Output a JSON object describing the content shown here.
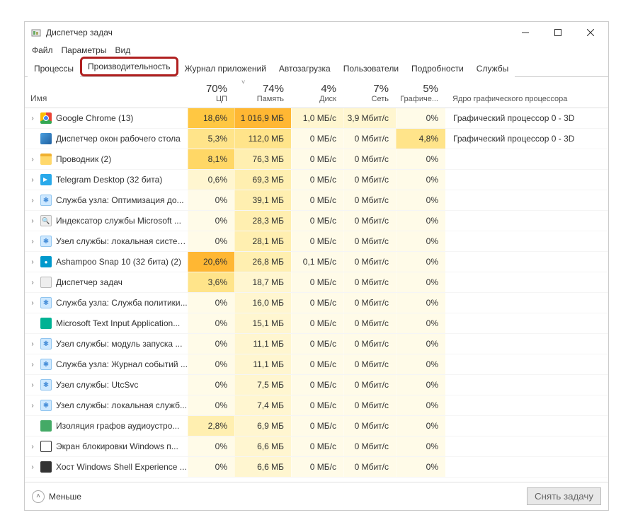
{
  "window": {
    "title": "Диспетчер задач"
  },
  "menu": {
    "file": "Файл",
    "options": "Параметры",
    "view": "Вид"
  },
  "tabs": {
    "processes": "Процессы",
    "performance": "Производительность",
    "app_history": "Журнал приложений",
    "startup": "Автозагрузка",
    "users": "Пользователи",
    "details": "Подробности",
    "services": "Службы"
  },
  "columns": {
    "name": "Имя",
    "cpu_pct": "70%",
    "cpu_label": "ЦП",
    "mem_pct": "74%",
    "mem_label": "Память",
    "disk_pct": "4%",
    "disk_label": "Диск",
    "net_pct": "7%",
    "net_label": "Сеть",
    "gpu_pct": "5%",
    "gpu_label": "Графиче...",
    "gpu_engine": "Ядро графического процессора"
  },
  "processes": [
    {
      "expand": true,
      "icon": "ic-chrome",
      "name": "Google Chrome (13)",
      "cpu": "18,6%",
      "cpu_h": 5,
      "mem": "1 016,9 МБ",
      "mem_h": 6,
      "disk": "1,0 МБ/с",
      "disk_h": 1,
      "net": "3,9 Мбит/с",
      "net_h": 1,
      "gpu": "0%",
      "gpu_h": 0,
      "engine": "Графический процессор 0 - 3D"
    },
    {
      "expand": false,
      "icon": "ic-dwm",
      "name": "Диспетчер окон рабочего стола",
      "cpu": "5,3%",
      "cpu_h": 3,
      "mem": "112,0 МБ",
      "mem_h": 3,
      "disk": "0 МБ/с",
      "disk_h": 0,
      "net": "0 Мбит/с",
      "net_h": 0,
      "gpu": "4,8%",
      "gpu_h": 3,
      "engine": "Графический процессор 0 - 3D"
    },
    {
      "expand": true,
      "icon": "ic-explorer",
      "name": "Проводник (2)",
      "cpu": "8,1%",
      "cpu_h": 4,
      "mem": "76,3 МБ",
      "mem_h": 2,
      "disk": "0 МБ/с",
      "disk_h": 0,
      "net": "0 Мбит/с",
      "net_h": 0,
      "gpu": "0%",
      "gpu_h": 0,
      "engine": ""
    },
    {
      "expand": true,
      "icon": "ic-telegram",
      "name": "Telegram Desktop (32 бита)",
      "cpu": "0,6%",
      "cpu_h": 1,
      "mem": "69,3 МБ",
      "mem_h": 2,
      "disk": "0 МБ/с",
      "disk_h": 0,
      "net": "0 Мбит/с",
      "net_h": 0,
      "gpu": "0%",
      "gpu_h": 0,
      "engine": ""
    },
    {
      "expand": true,
      "icon": "ic-svc",
      "name": "Служба узла: Оптимизация до...",
      "cpu": "0%",
      "cpu_h": 0,
      "mem": "39,1 МБ",
      "mem_h": 2,
      "disk": "0 МБ/с",
      "disk_h": 0,
      "net": "0 Мбит/с",
      "net_h": 0,
      "gpu": "0%",
      "gpu_h": 0,
      "engine": ""
    },
    {
      "expand": true,
      "icon": "ic-search",
      "name": "Индексатор службы Microsoft ...",
      "cpu": "0%",
      "cpu_h": 0,
      "mem": "28,3 МБ",
      "mem_h": 2,
      "disk": "0 МБ/с",
      "disk_h": 0,
      "net": "0 Мбит/с",
      "net_h": 0,
      "gpu": "0%",
      "gpu_h": 0,
      "engine": ""
    },
    {
      "expand": true,
      "icon": "ic-svc",
      "name": "Узел службы: локальная система",
      "cpu": "0%",
      "cpu_h": 0,
      "mem": "28,1 МБ",
      "mem_h": 2,
      "disk": "0 МБ/с",
      "disk_h": 0,
      "net": "0 Мбит/с",
      "net_h": 0,
      "gpu": "0%",
      "gpu_h": 0,
      "engine": ""
    },
    {
      "expand": true,
      "icon": "ic-snap",
      "name": "Ashampoo Snap 10 (32 бита) (2)",
      "cpu": "20,6%",
      "cpu_h": 6,
      "mem": "26,8 МБ",
      "mem_h": 2,
      "disk": "0,1 МБ/с",
      "disk_h": 0,
      "net": "0 Мбит/с",
      "net_h": 0,
      "gpu": "0%",
      "gpu_h": 0,
      "engine": ""
    },
    {
      "expand": true,
      "icon": "ic-tm",
      "name": "Диспетчер задач",
      "cpu": "3,6%",
      "cpu_h": 3,
      "mem": "18,7 МБ",
      "mem_h": 1,
      "disk": "0 МБ/с",
      "disk_h": 0,
      "net": "0 Мбит/с",
      "net_h": 0,
      "gpu": "0%",
      "gpu_h": 0,
      "engine": ""
    },
    {
      "expand": true,
      "icon": "ic-svc",
      "name": "Служба узла: Служба политики...",
      "cpu": "0%",
      "cpu_h": 0,
      "mem": "16,0 МБ",
      "mem_h": 1,
      "disk": "0 МБ/с",
      "disk_h": 0,
      "net": "0 Мбит/с",
      "net_h": 0,
      "gpu": "0%",
      "gpu_h": 0,
      "engine": ""
    },
    {
      "expand": false,
      "icon": "ic-teal",
      "name": "Microsoft Text Input Application...",
      "cpu": "0%",
      "cpu_h": 0,
      "mem": "15,1 МБ",
      "mem_h": 1,
      "disk": "0 МБ/с",
      "disk_h": 0,
      "net": "0 Мбит/с",
      "net_h": 0,
      "gpu": "0%",
      "gpu_h": 0,
      "engine": ""
    },
    {
      "expand": true,
      "icon": "ic-svc",
      "name": "Узел службы: модуль запуска ...",
      "cpu": "0%",
      "cpu_h": 0,
      "mem": "11,1 МБ",
      "mem_h": 1,
      "disk": "0 МБ/с",
      "disk_h": 0,
      "net": "0 Мбит/с",
      "net_h": 0,
      "gpu": "0%",
      "gpu_h": 0,
      "engine": ""
    },
    {
      "expand": true,
      "icon": "ic-svc",
      "name": "Служба узла: Журнал событий ...",
      "cpu": "0%",
      "cpu_h": 0,
      "mem": "11,1 МБ",
      "mem_h": 1,
      "disk": "0 МБ/с",
      "disk_h": 0,
      "net": "0 Мбит/с",
      "net_h": 0,
      "gpu": "0%",
      "gpu_h": 0,
      "engine": ""
    },
    {
      "expand": true,
      "icon": "ic-svc",
      "name": "Узел службы: UtcSvc",
      "cpu": "0%",
      "cpu_h": 0,
      "mem": "7,5 МБ",
      "mem_h": 1,
      "disk": "0 МБ/с",
      "disk_h": 0,
      "net": "0 Мбит/с",
      "net_h": 0,
      "gpu": "0%",
      "gpu_h": 0,
      "engine": ""
    },
    {
      "expand": true,
      "icon": "ic-svc",
      "name": "Узел службы: локальная служб...",
      "cpu": "0%",
      "cpu_h": 0,
      "mem": "7,4 МБ",
      "mem_h": 1,
      "disk": "0 МБ/с",
      "disk_h": 0,
      "net": "0 Мбит/с",
      "net_h": 0,
      "gpu": "0%",
      "gpu_h": 0,
      "engine": ""
    },
    {
      "expand": false,
      "icon": "ic-iso",
      "name": "Изоляция графов аудиоустро...",
      "cpu": "2,8%",
      "cpu_h": 2,
      "mem": "6,9 МБ",
      "mem_h": 1,
      "disk": "0 МБ/с",
      "disk_h": 0,
      "net": "0 Мбит/с",
      "net_h": 0,
      "gpu": "0%",
      "gpu_h": 0,
      "engine": ""
    },
    {
      "expand": true,
      "icon": "ic-lock",
      "name": "Экран блокировки Windows п...",
      "cpu": "0%",
      "cpu_h": 0,
      "mem": "6,6 МБ",
      "mem_h": 1,
      "disk": "0 МБ/с",
      "disk_h": 0,
      "net": "0 Мбит/с",
      "net_h": 0,
      "gpu": "0%",
      "gpu_h": 0,
      "engine": ""
    },
    {
      "expand": true,
      "icon": "ic-shell",
      "name": "Хост Windows Shell Experience ...",
      "cpu": "0%",
      "cpu_h": 0,
      "mem": "6,6 МБ",
      "mem_h": 1,
      "disk": "0 МБ/с",
      "disk_h": 0,
      "net": "0 Мбит/с",
      "net_h": 0,
      "gpu": "0%",
      "gpu_h": 0,
      "engine": ""
    }
  ],
  "footer": {
    "fewer": "Меньше",
    "end_task": "Снять задачу"
  }
}
